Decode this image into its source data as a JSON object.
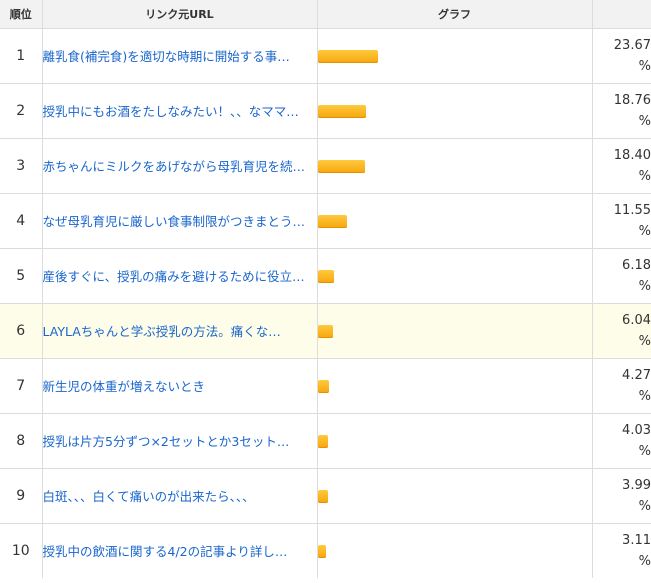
{
  "header": {
    "rank": "順位",
    "url": "リンク元URL",
    "graph": "グラフ",
    "share": ""
  },
  "rows": [
    {
      "rank": "1",
      "title": "離乳食(補完食)を適切な時期に開始する事…",
      "percent": "23.67",
      "unit": "%",
      "highlight": false
    },
    {
      "rank": "2",
      "title": "授乳中にもお酒をたしなみたい！、、なママ…",
      "percent": "18.76",
      "unit": "%",
      "highlight": false
    },
    {
      "rank": "3",
      "title": "赤ちゃんにミルクをあげながら母乳育児を続…",
      "percent": "18.40",
      "unit": "%",
      "highlight": false
    },
    {
      "rank": "4",
      "title": "なぜ母乳育児に厳しい食事制限がつきまとう…",
      "percent": "11.55",
      "unit": "%",
      "highlight": false
    },
    {
      "rank": "5",
      "title": "産後すぐに、授乳の痛みを避けるために役立…",
      "percent": "6.18",
      "unit": "%",
      "highlight": false
    },
    {
      "rank": "6",
      "title": "LAYLAちゃんと学ぶ授乳の方法。痛くな…",
      "percent": "6.04",
      "unit": "%",
      "highlight": true
    },
    {
      "rank": "7",
      "title": "新生児の体重が増えないとき",
      "percent": "4.27",
      "unit": "%",
      "highlight": false
    },
    {
      "rank": "8",
      "title": "授乳は片方5分ずつ×2セットとか3セット…",
      "percent": "4.03",
      "unit": "%",
      "highlight": false
    },
    {
      "rank": "9",
      "title": "白斑、、、白くて痛いのが出来たら、、、",
      "percent": "3.99",
      "unit": "%",
      "highlight": false
    },
    {
      "rank": "10",
      "title": "授乳中の飲酒に関する4/2の記事より詳し…",
      "percent": "3.11",
      "unit": "%",
      "highlight": false
    }
  ],
  "colors": {
    "link": "#1a66cc",
    "bar": "#f7a60d",
    "highlight_row": "#fdfde9",
    "header_bg": "#f2f2f2"
  }
}
